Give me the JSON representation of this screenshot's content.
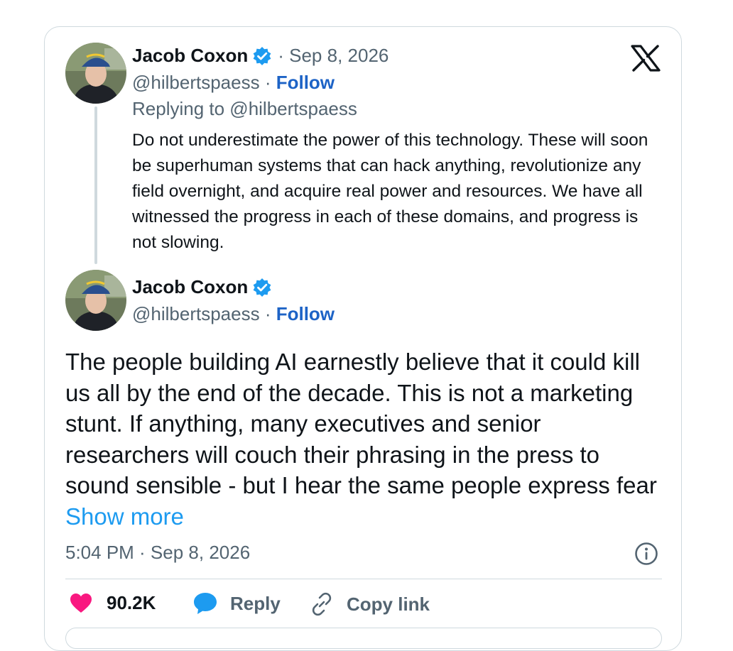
{
  "quoted_tweet": {
    "author_name": "Jacob Coxon",
    "date": "· Sep 8, 2026",
    "handle": "@hilbertspaess",
    "separator": " · ",
    "follow_label": "Follow",
    "replying_to": "Replying to @hilbertspaess",
    "text": "Do not underestimate the power of this technology. These will soon be superhuman systems that can hack anything, revolutionize any field overnight, and acquire real power and resources. We have all witnessed the progress in each of these domains, and progress is not slowing."
  },
  "main_tweet": {
    "author_name": "Jacob Coxon",
    "handle": "@hilbertspaess",
    "separator": " · ",
    "follow_label": "Follow",
    "text": "The people building AI earnestly believe that it could kill us all by the end of the decade. This is not a marketing stunt. If anything, many executives and senior researchers will couch their phrasing in the press to sound sensible - but I hear the same people express fear ",
    "show_more_label": "Show more",
    "timestamp": "5:04 PM · Sep 8, 2026"
  },
  "actions": {
    "like_count": "90.2K",
    "reply_label": "Reply",
    "copy_link_label": "Copy link"
  },
  "icons": {
    "brand": "x-logo-icon",
    "verified": "verified-badge-icon",
    "info": "info-icon",
    "like": "heart-icon",
    "reply": "speech-bubble-icon",
    "link": "link-icon"
  },
  "colors": {
    "link_blue": "#1d63c6",
    "show_more_blue": "#1d9bf0",
    "verified_blue": "#1d9bf0",
    "heart_pink": "#f91880",
    "muted_text": "#536471",
    "border": "#cfd9de"
  }
}
